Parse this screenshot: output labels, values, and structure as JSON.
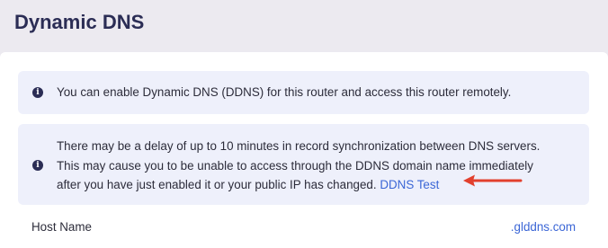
{
  "page": {
    "title": "Dynamic DNS"
  },
  "notices": [
    {
      "icon": "info-icon",
      "text": "You can enable Dynamic DNS (DDNS) for this router and access this router remotely."
    },
    {
      "icon": "info-icon",
      "lines": [
        "There may be a delay of up to 10 minutes in record synchronization between DNS servers.",
        "This may cause you to be unable to access through the DDNS domain name immediately",
        "after you have just enabled it or your public IP has changed."
      ],
      "link_label": "DDNS Test"
    }
  ],
  "host_name": {
    "label": "Host Name",
    "value": ".glddns.com"
  },
  "colors": {
    "title": "#2b2d55",
    "notice_background": "#eef0fb",
    "link": "#3b66d6",
    "annotation_arrow": "#e2402e"
  }
}
